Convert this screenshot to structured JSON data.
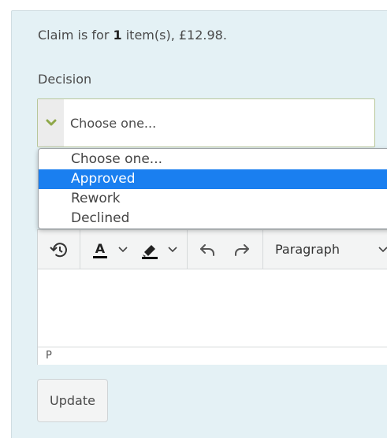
{
  "summary": {
    "prefix": "Claim is for ",
    "count": "1",
    "suffix": " item(s), £12.98."
  },
  "decision": {
    "label": "Decision",
    "selected_value": "Choose one...",
    "options": [
      {
        "label": "Choose one...",
        "selected": false
      },
      {
        "label": "Approved",
        "selected": true
      },
      {
        "label": "Rework",
        "selected": false
      },
      {
        "label": "Declined",
        "selected": false
      }
    ]
  },
  "editor": {
    "block_format": "Paragraph",
    "status_path": "P",
    "toolbar_icons": [
      "history-icon",
      "text-color-icon",
      "highlight-color-icon",
      "undo-icon",
      "redo-icon"
    ]
  },
  "actions": {
    "update_label": "Update"
  },
  "colors": {
    "panel_bg": "#e4f1f5",
    "select_border": "#b8c79a",
    "chevron": "#8fa84a",
    "highlight": "#1a7ff0"
  }
}
